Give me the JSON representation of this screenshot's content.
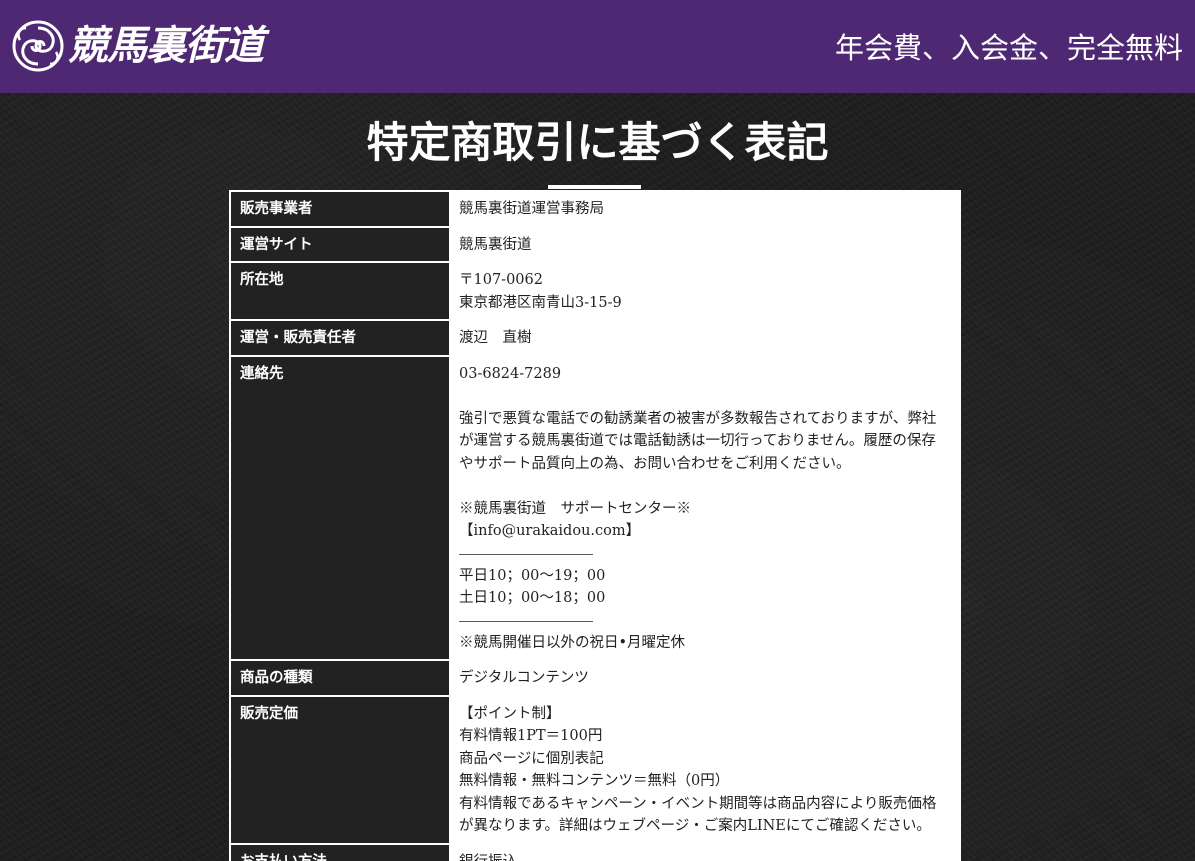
{
  "header": {
    "logo_text": "競馬裏街道",
    "tagline": "年会費、入会金、完全無料"
  },
  "page": {
    "title": "特定商取引に基づく表記"
  },
  "table": {
    "rows": [
      {
        "label": "販売事業者",
        "lines": [
          "競馬裏街道運営事務局"
        ]
      },
      {
        "label": "運営サイト",
        "lines": [
          "競馬裏街道"
        ]
      },
      {
        "label": "所在地",
        "lines": [
          "〒107-0062",
          "東京都港区南青山3-15-9"
        ]
      },
      {
        "label": "運営・販売責任者",
        "lines": [
          "渡辺　直樹"
        ]
      },
      {
        "label": "連絡先",
        "phone": "03-6824-7289",
        "paragraph": [
          "強引で悪質な電話での勧誘業者の被害が多数報告されておりますが、弊社",
          "が運営する競馬裏街道では電話勧誘は一切行っておりません。履歴の保存",
          "やサポート品質向上の為、お問い合わせをご利用ください。"
        ],
        "support_center": "※競馬裏街道　サポートセンター※",
        "email": "【info@urakaidou.com】",
        "hours_weekday": "平日10；00～19；00",
        "hours_weekend": "土日10；00～18；00",
        "closed": "※競馬開催日以外の祝日•月曜定休"
      },
      {
        "label": "商品の種類",
        "lines": [
          "デジタルコンテンツ"
        ]
      },
      {
        "label": "販売定価",
        "lines": [
          "【ポイント制】",
          "有料情報1PT＝100円",
          "商品ページに個別表記",
          "無料情報・無料コンテンツ＝無料（0円）",
          "有料情報であるキャンペーン・イベント期間等は商品内容により販売価格",
          "が異なります。詳細はウェブページ・ご案内LINEにてご確認ください。"
        ]
      },
      {
        "label": "お支払い方法",
        "lines": [
          "銀行振込"
        ]
      }
    ]
  },
  "colors": {
    "header_bg": "#4e2873",
    "page_bg": "#1e1e1e",
    "label_bg": "#222222",
    "value_bg": "#ffffff"
  },
  "icons": {
    "logo": "swirl-emblem-icon"
  }
}
